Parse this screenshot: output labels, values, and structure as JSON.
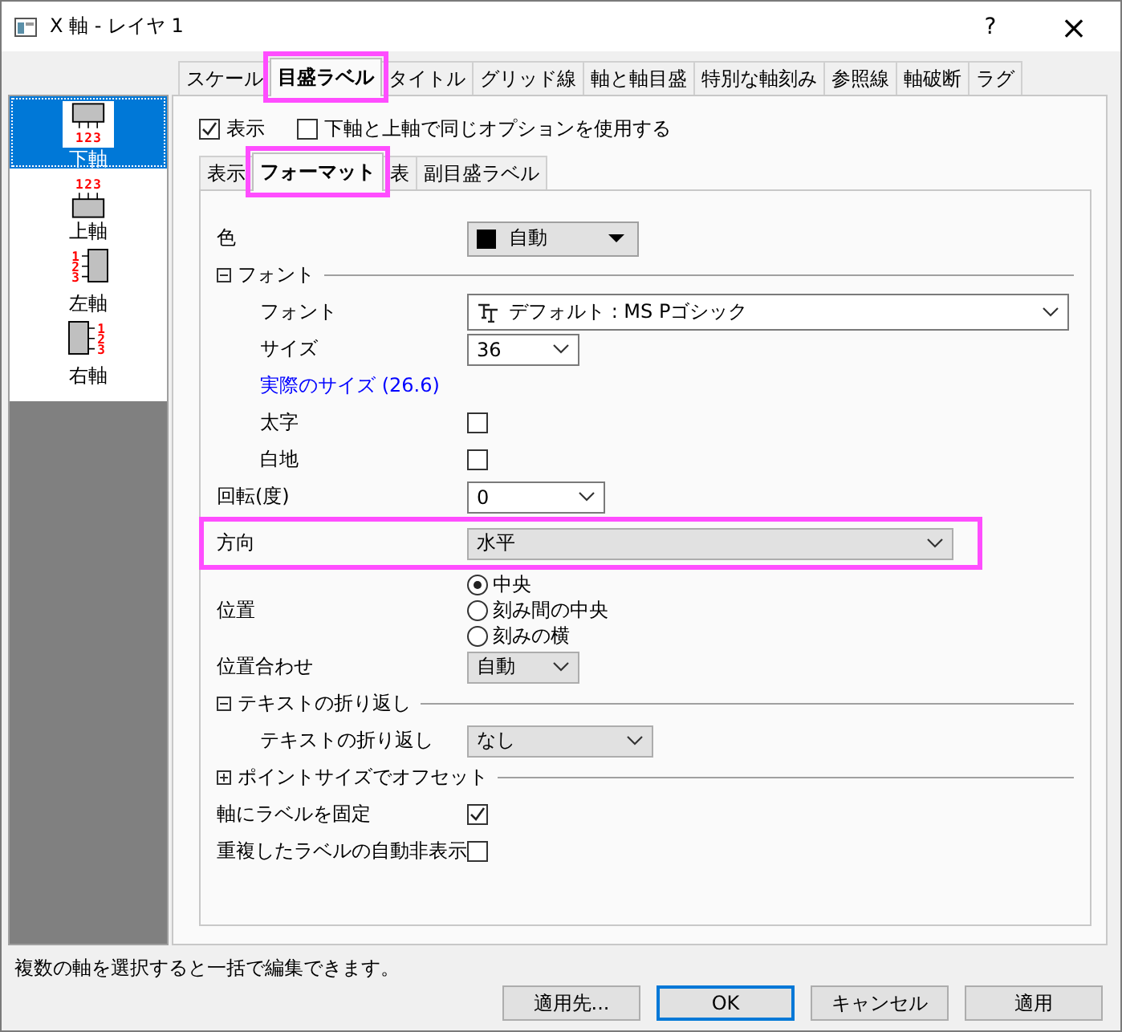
{
  "window": {
    "title": "X 軸 - レイヤ 1",
    "help": "?",
    "close": "×"
  },
  "sidebar": {
    "items": [
      {
        "kind": "bottom",
        "label": "下軸",
        "tick_labels": [
          "1",
          "2",
          "3"
        ],
        "selected": true
      },
      {
        "kind": "top",
        "label": "上軸",
        "tick_labels": [
          "1",
          "2",
          "3"
        ],
        "selected": false
      },
      {
        "kind": "left",
        "label": "左軸",
        "tick_labels": [
          "1",
          "2",
          "3"
        ],
        "selected": false
      },
      {
        "kind": "right",
        "label": "右軸",
        "tick_labels": [
          "1",
          "2",
          "3"
        ],
        "selected": false
      }
    ]
  },
  "tabs": [
    {
      "label": "スケール",
      "selected": false,
      "highlighted": false
    },
    {
      "label": "目盛ラベル",
      "selected": true,
      "highlighted": true
    },
    {
      "label": "タイトル",
      "selected": false,
      "highlighted": false
    },
    {
      "label": "グリッド線",
      "selected": false,
      "highlighted": false
    },
    {
      "label": "軸と軸目盛",
      "selected": false,
      "highlighted": false
    },
    {
      "label": "特別な軸刻み",
      "selected": false,
      "highlighted": false
    },
    {
      "label": "参照線",
      "selected": false,
      "highlighted": false
    },
    {
      "label": "軸破断",
      "selected": false,
      "highlighted": false
    },
    {
      "label": "ラグ",
      "selected": false,
      "highlighted": false
    }
  ],
  "options": [
    {
      "label": "表示",
      "checked": true
    },
    {
      "label": "下軸と上軸で同じオプションを使用する",
      "checked": false
    }
  ],
  "subtabs": [
    {
      "label": "表示",
      "selected": false,
      "highlighted": false
    },
    {
      "label": "フォーマット",
      "selected": true,
      "highlighted": true
    },
    {
      "label": "表",
      "selected": false,
      "highlighted": false
    },
    {
      "label": "副目盛ラベル",
      "selected": false,
      "highlighted": false
    }
  ],
  "settings": [
    {
      "kind": "color",
      "label": "色",
      "value": "自動"
    },
    {
      "kind": "section",
      "label": "フォント",
      "expanded": true,
      "children": [
        {
          "kind": "font",
          "label": "フォント",
          "value": "デフォルト : MS Pゴシック"
        },
        {
          "kind": "combo",
          "label": "サイズ",
          "value": "36"
        },
        {
          "kind": "link",
          "label": "実際のサイズ (26.6)"
        },
        {
          "kind": "checkbox",
          "label": "太字",
          "checked": false
        },
        {
          "kind": "checkbox",
          "label": "白地",
          "checked": false
        }
      ]
    },
    {
      "kind": "combo",
      "label": "回転(度)",
      "value": "0"
    },
    {
      "kind": "dropdown",
      "label": "方向",
      "value": "水平",
      "highlighted": true
    },
    {
      "kind": "radio",
      "label": "位置",
      "options": [
        {
          "label": "中央",
          "selected": true
        },
        {
          "label": "刻み間の中央",
          "selected": false
        },
        {
          "label": "刻みの横",
          "selected": false
        }
      ]
    },
    {
      "kind": "dropdown",
      "label": "位置合わせ",
      "value": "自動"
    },
    {
      "kind": "section",
      "label": "テキストの折り返し",
      "expanded": true,
      "children": [
        {
          "kind": "dropdown",
          "label": "テキストの折り返し",
          "value": "なし"
        }
      ]
    },
    {
      "kind": "section",
      "label": "ポイントサイズでオフセット",
      "expanded": false
    },
    {
      "kind": "checkbox",
      "label": "軸にラベルを固定",
      "checked": true
    },
    {
      "kind": "checkbox",
      "label": "重複したラベルの自動非表示",
      "checked": false
    }
  ],
  "status_bar": "複数の軸を選択すると一括で編集できます。",
  "buttons": [
    {
      "label": "適用先...",
      "default": false
    },
    {
      "label": "OK",
      "default": true
    },
    {
      "label": "キャンセル",
      "default": false
    },
    {
      "label": "適用",
      "default": false
    }
  ]
}
